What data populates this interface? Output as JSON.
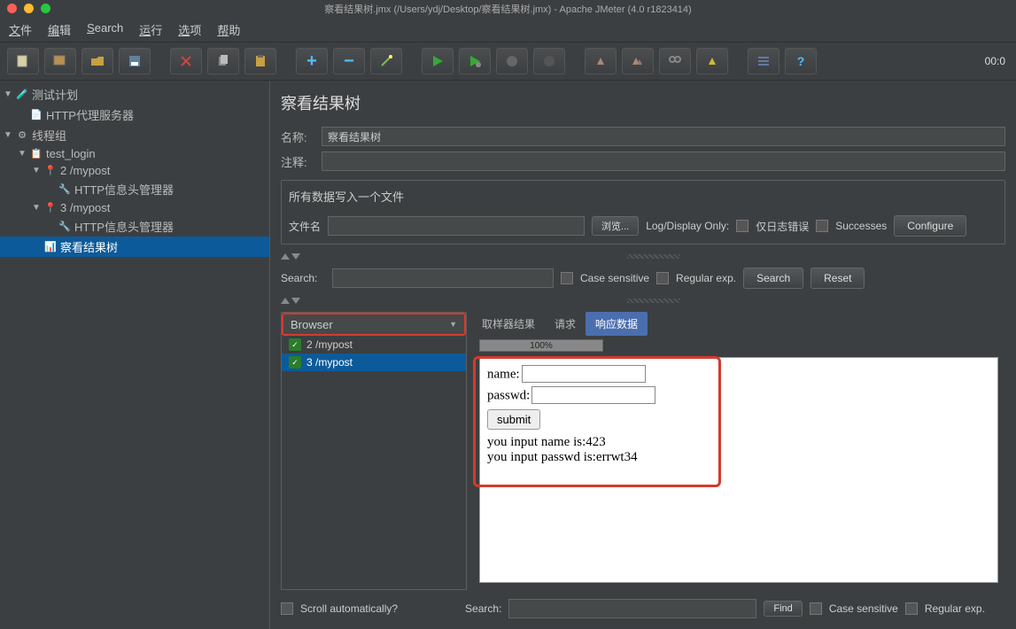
{
  "app": {
    "title": "察看结果树.jmx (/Users/ydj/Desktop/察看结果树.jmx) - Apache JMeter (4.0 r1823414)"
  },
  "menu": [
    "文件",
    "编辑",
    "Search",
    "运行",
    "选项",
    "帮助"
  ],
  "toolbar_time": "00:0",
  "tree": {
    "items": [
      {
        "label": "测试计划",
        "icon": "plan",
        "indent": 0,
        "toggle": "▼"
      },
      {
        "label": "HTTP代理服务器",
        "icon": "proxy",
        "indent": 1,
        "toggle": ""
      },
      {
        "label": "线程组",
        "icon": "thread",
        "indent": 0,
        "toggle": "▼"
      },
      {
        "label": "test_login",
        "icon": "controller",
        "indent": 1,
        "toggle": "▼"
      },
      {
        "label": "2 /mypost",
        "icon": "sampler",
        "indent": 2,
        "toggle": "▼"
      },
      {
        "label": "HTTP信息头管理器",
        "icon": "header",
        "indent": 3,
        "toggle": ""
      },
      {
        "label": "3 /mypost",
        "icon": "sampler",
        "indent": 2,
        "toggle": "▼"
      },
      {
        "label": "HTTP信息头管理器",
        "icon": "header",
        "indent": 3,
        "toggle": ""
      },
      {
        "label": "察看结果树",
        "icon": "results",
        "indent": 2,
        "toggle": "",
        "selected": true
      }
    ]
  },
  "panel": {
    "title": "察看结果树",
    "name_label": "名称:",
    "name_value": "察看结果树",
    "comment_label": "注释:",
    "filegroup_title": "所有数据写入一个文件",
    "filename_label": "文件名",
    "browse_btn": "浏览...",
    "log_display_label": "Log/Display Only:",
    "errors_only_label": "仅日志错误",
    "successes_label": "Successes",
    "configure_btn": "Configure",
    "search_label": "Search:",
    "case_label": "Case sensitive",
    "regex_label": "Regular exp.",
    "search_btn": "Search",
    "reset_btn": "Reset",
    "renderer_label": "Browser",
    "results": [
      {
        "label": "2 /mypost",
        "selected": false
      },
      {
        "label": "3 /mypost",
        "selected": true
      }
    ],
    "tabs": {
      "sampler": "取样器结果",
      "request": "请求",
      "response": "响应数据"
    },
    "progress": "100%",
    "response": {
      "name_label": "name:",
      "passwd_label": "passwd:",
      "submit_label": "submit",
      "line1": "you input name is:423",
      "line2": "you input passwd is:errwt34"
    },
    "scroll_auto_label": "Scroll automatically?",
    "bottom_search_label": "Search:",
    "find_btn": "Find",
    "bottom_case_label": "Case sensitive",
    "bottom_regex_label": "Regular exp."
  }
}
